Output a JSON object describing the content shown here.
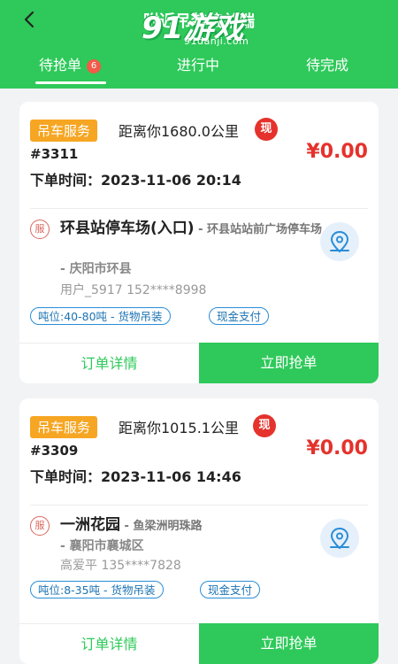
{
  "header": {
    "title": "附近吊装接单端",
    "watermark_main": "91游戏",
    "watermark_sub": "91danji.com"
  },
  "tabs": [
    {
      "label": "待抢单",
      "badge": "6"
    },
    {
      "label": "进行中"
    },
    {
      "label": "待完成"
    }
  ],
  "colors": {
    "brand_green": "#2ec95a",
    "price_red": "#e5322c",
    "tag_orange": "#f6a623",
    "chip_blue": "#2a8dd6"
  },
  "orders": [
    {
      "service_tag": "吊车服务",
      "distance": "距离你1680.0公里",
      "cash_badge": "现",
      "order_no": "#3311",
      "price": "¥0.00",
      "order_time": "下单时间：2023-11-06 20:14",
      "svc_badge": "服",
      "addr_name": "环县站停车场(入口)",
      "addr_detail": " - 环县站站前广场停车场",
      "addr_city": "- 庆阳市环县",
      "user": "用户_5917   152****8998",
      "chips": [
        "吨位:40-80吨 - 货物吊装",
        "现金支付"
      ],
      "detail_btn": "订单详情",
      "grab_btn": "立即抢单",
      "location_icon": "map-location-icon"
    },
    {
      "service_tag": "吊车服务",
      "distance": "距离你1015.1公里",
      "cash_badge": "现",
      "order_no": "#3309",
      "price": "¥0.00",
      "order_time": "下单时间：2023-11-06 14:46",
      "svc_badge": "服",
      "addr_name": "一洲花园",
      "addr_detail": " - 鱼梁洲明珠路",
      "addr_city": "- 襄阳市襄城区",
      "user": "高爱平   135****7828",
      "chips": [
        "吨位:8-35吨 - 货物吊装",
        "现金支付"
      ],
      "detail_btn": "订单详情",
      "grab_btn": "立即抢单",
      "location_icon": "map-location-icon"
    }
  ]
}
